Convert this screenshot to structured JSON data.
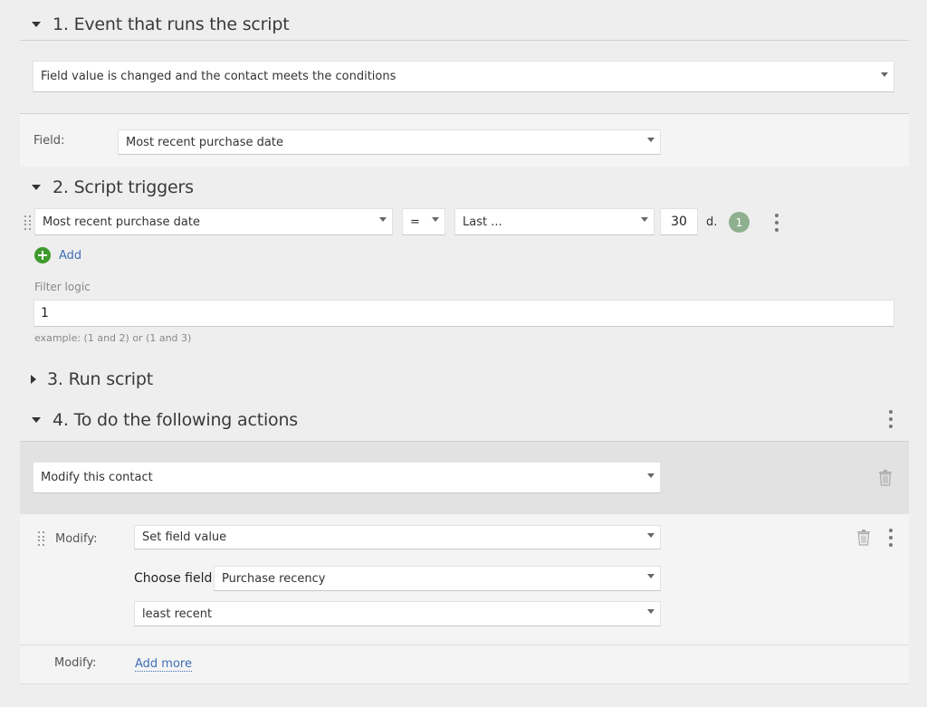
{
  "section1": {
    "title": "1. Event that runs the script",
    "event_select": "Field value is changed and the contact meets the conditions",
    "field_label": "Field:",
    "field_select": "Most recent purchase date"
  },
  "section2": {
    "title": "2. Script triggers",
    "condition": {
      "field": "Most recent purchase date",
      "operator": "=",
      "period": "Last ...",
      "value": "30",
      "unit": "d.",
      "index": "1"
    },
    "add_label": "Add",
    "filter_logic_label": "Filter logic",
    "filter_logic_value": "1",
    "filter_logic_hint": "example: (1 and 2) or (1 and 3)"
  },
  "section3": {
    "title": "3. Run script"
  },
  "section4": {
    "title": "4. To do the following actions",
    "action_select": "Modify this contact",
    "modify_label": "Modify:",
    "modify_select": "Set field value",
    "choose_field_label": "Choose field:",
    "choose_field_select": "Purchase recency",
    "value_select": "least recent",
    "modify_label_2": "Modify:",
    "add_more_label": "Add more"
  },
  "icons": {
    "collapse": "caret-down-icon",
    "expand": "caret-right-icon",
    "menu": "kebab-menu-icon",
    "drag": "drag-handle-icon",
    "add": "plus-circle-icon",
    "delete": "trash-icon"
  },
  "colors": {
    "add_green": "#3f9a2c",
    "link_blue": "#3f6fb5",
    "badge_green": "#8fb08f"
  }
}
